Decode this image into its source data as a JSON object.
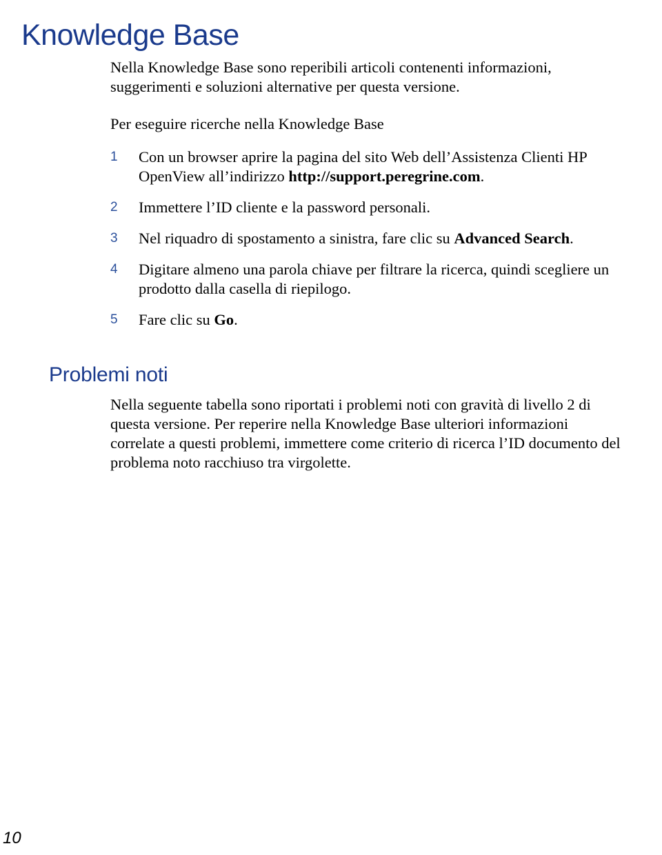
{
  "page": {
    "title": "Knowledge Base",
    "page_number": "10",
    "accent_color": "#1a3a8c",
    "list_number_color": "#2a4f9b",
    "background_color": "#ffffff",
    "text_color": "#000000"
  },
  "intro": {
    "paragraph": "Nella Knowledge Base sono reperibili articoli contenenti informazioni, suggerimenti e soluzioni alternative per questa versione.",
    "lead_in": "Per eseguire ricerche nella Knowledge Base"
  },
  "steps": [
    {
      "number": "1",
      "text_before": "Con un browser aprire la pagina del sito Web dell’Assistenza Clienti HP OpenView all’indirizzo ",
      "bold": "http://support.peregrine.com",
      "text_after": "."
    },
    {
      "number": "2",
      "text_before": "Immettere l’ID cliente e la password personali.",
      "bold": "",
      "text_after": ""
    },
    {
      "number": "3",
      "text_before": "Nel riquadro di spostamento a sinistra, fare clic su ",
      "bold": "Advanced Search",
      "text_after": "."
    },
    {
      "number": "4",
      "text_before": "Digitare almeno una parola chiave per filtrare la ricerca, quindi scegliere un prodotto dalla casella di riepilogo.",
      "bold": "",
      "text_after": ""
    },
    {
      "number": "5",
      "text_before": "Fare clic su ",
      "bold": "Go",
      "text_after": "."
    }
  ],
  "known_issues": {
    "heading": "Problemi noti",
    "paragraph": "Nella seguente tabella sono riportati i problemi noti con gravità di livello 2 di questa versione. Per reperire nella Knowledge Base ulteriori informazioni correlate a questi problemi, immettere come criterio di ricerca l’ID documento del problema noto racchiuso tra virgolette."
  }
}
